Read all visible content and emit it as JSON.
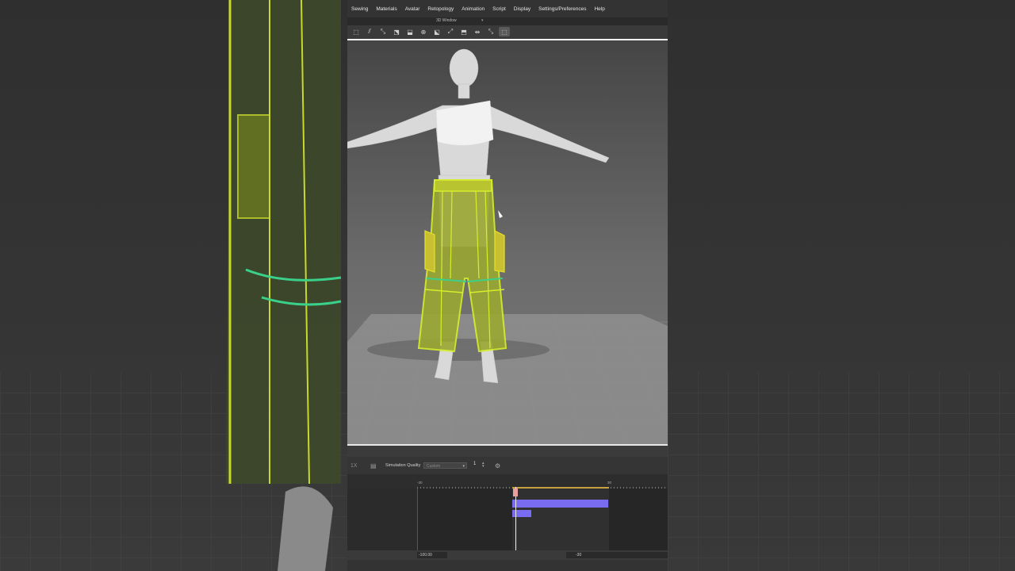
{
  "menu": [
    "Sewing",
    "Materials",
    "Avatar",
    "Retopology",
    "Animation",
    "Script",
    "Display",
    "Settings/Preferences",
    "Help"
  ],
  "tab": {
    "label": "3D Window",
    "arrow": "▾"
  },
  "toolbar": {
    "tools": [
      "⬚",
      "⫽",
      "⤡",
      "⬔",
      "⬓",
      "⊕",
      "⬕",
      "⤢",
      "⬒",
      "⇹",
      "⤡",
      "⬚"
    ]
  },
  "timeline": {
    "speed": "1X",
    "sim_quality_label": "Simulation Quality",
    "sim_quality_value": "Custom",
    "sim_count": "1",
    "ruler_left": "-30",
    "ruler_right": "30",
    "start_field": "-100.00",
    "end_field": "-30"
  },
  "colors": {
    "garment": "#c8e62a",
    "clips": "#7a6cf0",
    "accent": "#c8a040"
  }
}
